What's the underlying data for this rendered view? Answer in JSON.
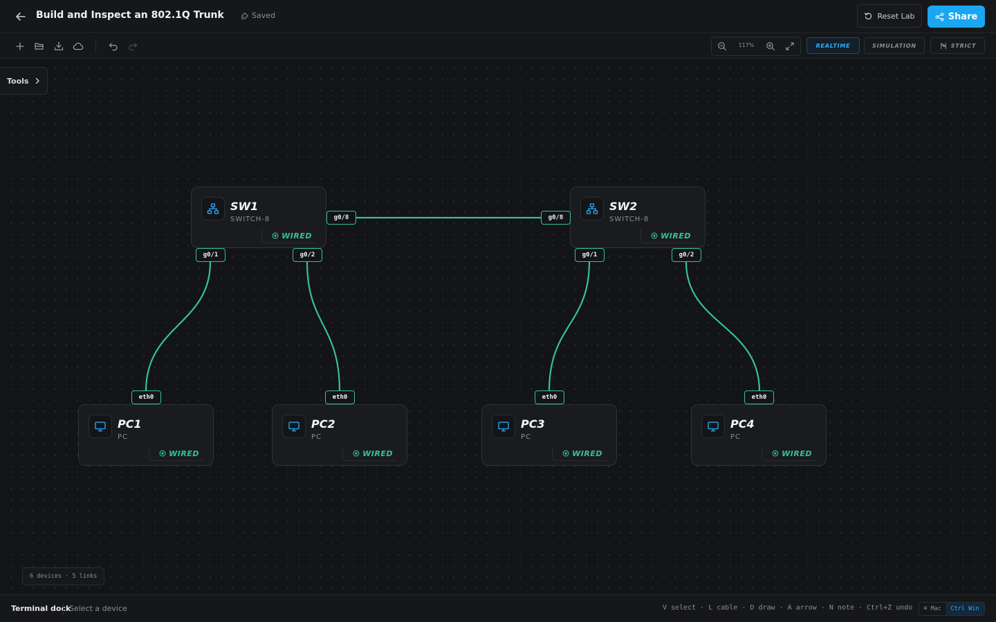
{
  "header": {
    "title": "Build and Inspect an 802.1Q Trunk",
    "save_status": "Saved",
    "reset_label": "Reset Lab",
    "share_label": "Share"
  },
  "toolbar": {
    "icons": [
      "plus-icon",
      "folder-open-icon",
      "download-icon",
      "cloud-icon",
      "undo-icon",
      "redo-icon"
    ],
    "zoom_level": "117%",
    "modes": [
      {
        "label": "REALTIME",
        "active": true
      },
      {
        "label": "SIMULATION",
        "active": false
      },
      {
        "label": "STRICT",
        "active": false
      }
    ]
  },
  "tools_panel": {
    "label": "Tools"
  },
  "devices": [
    {
      "name": "SW1",
      "type": "SWITCH-8",
      "status": "WIRED",
      "icon": "network-switch-icon"
    },
    {
      "name": "SW2",
      "type": "SWITCH-8",
      "status": "WIRED",
      "icon": "network-switch-icon"
    },
    {
      "name": "PC1",
      "type": "PC",
      "status": "WIRED",
      "icon": "monitor-icon"
    },
    {
      "name": "PC2",
      "type": "PC",
      "status": "WIRED",
      "icon": "monitor-icon"
    },
    {
      "name": "PC3",
      "type": "PC",
      "status": "WIRED",
      "icon": "monitor-icon"
    },
    {
      "name": "PC4",
      "type": "PC",
      "status": "WIRED",
      "icon": "monitor-icon"
    }
  ],
  "links": [
    {
      "from": "SW1",
      "from_port": "g0/8",
      "to": "SW2",
      "to_port": "g0/8"
    },
    {
      "from": "SW1",
      "from_port": "g0/1",
      "to": "PC1",
      "to_port": "eth0"
    },
    {
      "from": "SW1",
      "from_port": "g0/2",
      "to": "PC2",
      "to_port": "eth0"
    },
    {
      "from": "SW2",
      "from_port": "g0/1",
      "to": "PC3",
      "to_port": "eth0"
    },
    {
      "from": "SW2",
      "from_port": "g0/2",
      "to": "PC4",
      "to_port": "eth0"
    }
  ],
  "canvas_summary": "6 devices · 5 links",
  "footer": {
    "dock_label": "Terminal dock",
    "dock_hint": "Select a device",
    "shortcuts": "V select · L cable · D draw · A arrow · N note · Ctrl+Z undo",
    "os_mac": "⌘ Mac",
    "os_win": "Ctrl Win"
  },
  "colors": {
    "accent": "#1aa6f0",
    "link": "#35c48e",
    "background": "#131417"
  }
}
